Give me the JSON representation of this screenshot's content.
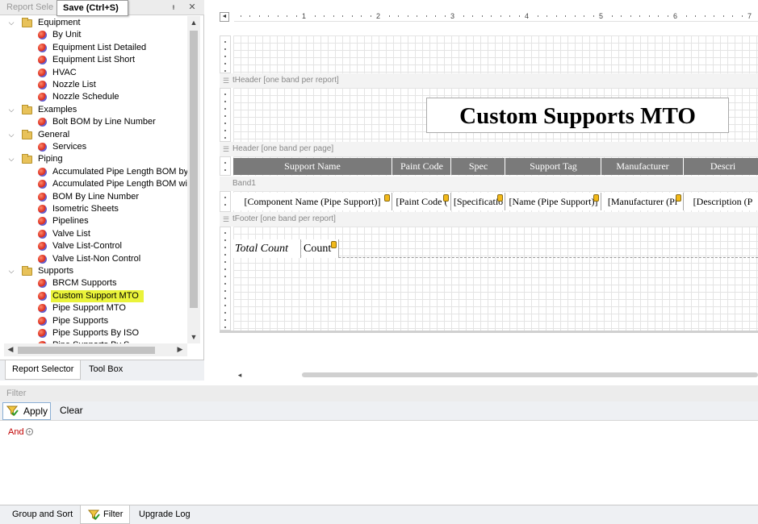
{
  "left_panel": {
    "title": "Report Sele",
    "tooltip": "Save (Ctrl+S)",
    "pin_glyph": "ᵻ",
    "close_glyph": "✕",
    "tree": [
      {
        "type": "folder",
        "label": "Equipment"
      },
      {
        "type": "report",
        "label": "By Unit"
      },
      {
        "type": "report",
        "label": "Equipment List Detailed"
      },
      {
        "type": "report",
        "label": "Equipment List Short"
      },
      {
        "type": "report",
        "label": "HVAC"
      },
      {
        "type": "report",
        "label": "Nozzle List"
      },
      {
        "type": "report",
        "label": "Nozzle Schedule"
      },
      {
        "type": "folder",
        "label": "Examples"
      },
      {
        "type": "report",
        "label": "Bolt BOM by Line Number"
      },
      {
        "type": "folder",
        "label": "General"
      },
      {
        "type": "report",
        "label": "Services"
      },
      {
        "type": "folder",
        "label": "Piping"
      },
      {
        "type": "report",
        "label": "Accumulated Pipe Length BOM by S"
      },
      {
        "type": "report",
        "label": "Accumulated Pipe Length BOM with"
      },
      {
        "type": "report",
        "label": "BOM By Line Number"
      },
      {
        "type": "report",
        "label": "Isometric Sheets"
      },
      {
        "type": "report",
        "label": "Pipelines"
      },
      {
        "type": "report",
        "label": "Valve List"
      },
      {
        "type": "report",
        "label": "Valve List-Control"
      },
      {
        "type": "report",
        "label": "Valve List-Non Control"
      },
      {
        "type": "folder",
        "label": "Supports"
      },
      {
        "type": "report",
        "label": "BRCM Supports"
      },
      {
        "type": "report",
        "label": "Custom Support MTO",
        "selected": true
      },
      {
        "type": "report",
        "label": "Pipe Support MTO"
      },
      {
        "type": "report",
        "label": "Pipe Supports"
      },
      {
        "type": "report",
        "label": "Pipe Supports By ISO"
      },
      {
        "type": "report",
        "label": "Pipe Supports By S"
      }
    ],
    "tabs": [
      "Report Selector",
      "Tool Box"
    ],
    "selection_color": "#eaf33a"
  },
  "designer": {
    "ruler_numbers": [
      "1",
      "2",
      "3",
      "4",
      "5",
      "6",
      "7"
    ],
    "bands": {
      "report_header": "tHeader [one band per report]",
      "page_header": "Header [one band per page]",
      "detail": "Band1",
      "report_footer": "tFooter [one band per report]"
    },
    "title": "Custom Supports MTO",
    "header_cells": [
      "Support Name",
      "Paint Code",
      "Spec",
      "Support Tag",
      "Manufacturer",
      "Descri"
    ],
    "detail_cells": [
      "[Component Name (Pipe Support)]",
      "[Paint Code (",
      "[Specificatio",
      "[Name (Pipe Support)]",
      "[Manufacturer (Pi",
      "[Description (P"
    ],
    "total_label": "Total Count",
    "count_label": "Count",
    "header_color": "#7a7a7a"
  },
  "filter": {
    "title": "Filter",
    "apply_label": "Apply",
    "clear_label": "Clear",
    "and_label": "And",
    "and_color": "#c00000"
  },
  "bottom_tabs": [
    "Group and Sort",
    "Filter",
    "Upgrade Log"
  ]
}
